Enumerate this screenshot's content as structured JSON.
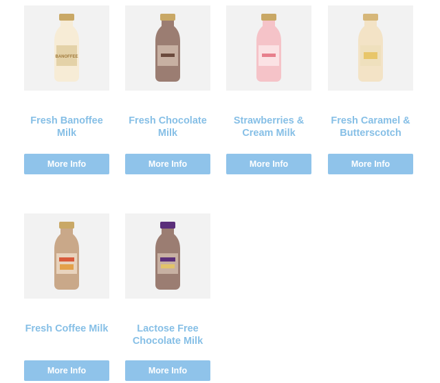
{
  "products": [
    {
      "name": "Fresh Banoffee Milk",
      "name_lines": [
        "Fresh Banoffee",
        "Milk"
      ],
      "button_label": "More Info",
      "label_text": "BANOFFEE",
      "cap_color": "#c9a866",
      "body_color": "#f7ecd6",
      "label_color": "#e4d2a8"
    },
    {
      "name": "Fresh Chocolate Milk",
      "name_lines": [
        "Fresh Chocolate",
        "Milk"
      ],
      "button_label": "More Info",
      "label_text": "",
      "cap_color": "#c9a866",
      "body_color": "#9b7d72",
      "label_color": "#c7b0a2"
    },
    {
      "name": "Strawberries & Cream Milk",
      "name_lines": [
        "Strawberries &",
        "Cream Milk"
      ],
      "button_label": "More Info",
      "label_text": "",
      "cap_color": "#c9a866",
      "body_color": "#f5c3c8",
      "label_color": "#fbe2e4"
    },
    {
      "name": "Fresh Caramel & Butterscotch",
      "name_lines": [
        "Fresh Caramel &",
        "Butterscotch"
      ],
      "button_label": "More Info",
      "label_text": "",
      "cap_color": "#d6b77a",
      "body_color": "#f3e3c6",
      "label_color": "#e8c66a"
    },
    {
      "name": "Fresh Coffee Milk",
      "name_lines": [
        "Fresh Coffee Milk"
      ],
      "button_label": "More Info",
      "label_text": "",
      "cap_color": "#c9a866",
      "body_color": "#c9a889",
      "label_color": "#e3a14a"
    },
    {
      "name": "Lactose Free Chocolate Milk",
      "name_lines": [
        "Lactose Free",
        "Chocolate Milk"
      ],
      "button_label": "More Info",
      "label_text": "",
      "cap_color": "#5b2f7a",
      "body_color": "#9b7d72",
      "label_color": "#c7b0a2"
    }
  ]
}
